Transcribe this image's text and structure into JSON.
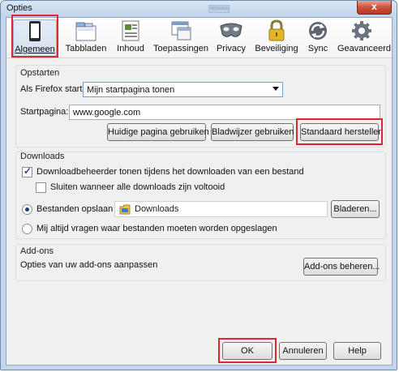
{
  "window": {
    "title": "Opties",
    "ghost_tab": "Verbeteren",
    "close_glyph": "x"
  },
  "toolbar": {
    "tabs": [
      {
        "label": "Algemeen",
        "icon": "general-panel-icon",
        "selected": true
      },
      {
        "label": "Tabbladen",
        "icon": "tabs-panel-icon",
        "selected": false
      },
      {
        "label": "Inhoud",
        "icon": "content-panel-icon",
        "selected": false
      },
      {
        "label": "Toepassingen",
        "icon": "applications-panel-icon",
        "selected": false
      },
      {
        "label": "Privacy",
        "icon": "privacy-mask-icon",
        "selected": false
      },
      {
        "label": "Beveiliging",
        "icon": "padlock-icon",
        "selected": false
      },
      {
        "label": "Sync",
        "icon": "sync-icon",
        "selected": false
      },
      {
        "label": "Geavanceerd",
        "icon": "gear-icon",
        "selected": false
      }
    ]
  },
  "startup": {
    "section_title": "Opstarten",
    "when_starts_label": "Als Firefox start:",
    "when_starts_value": "Mijn startpagina tonen",
    "homepage_label": "Startpagina:",
    "homepage_value": "www.google.com",
    "use_current_button": "Huidige pagina gebruiken",
    "use_bookmark_button": "Bladwijzer gebruiken",
    "restore_default_button": "Standaard herstellen"
  },
  "downloads": {
    "section_title": "Downloads",
    "show_manager_label": "Downloadbeheerder tonen tijdens het downloaden van een bestand",
    "show_manager_checked": true,
    "close_when_done_label": "Sluiten wanneer alle downloads zijn voltooid",
    "close_when_done_checked": false,
    "save_to_label": "Bestanden opslaan in",
    "save_to_folder": "Downloads",
    "browse_button": "Bladeren...",
    "always_ask_label": "Mij altijd vragen waar bestanden moeten worden opgeslagen"
  },
  "addons": {
    "section_title": "Add-ons",
    "options_label": "Opties van uw add-ons aanpassen",
    "manage_button": "Add-ons beheren..."
  },
  "footer": {
    "ok_button": "OK",
    "cancel_button": "Annuleren",
    "help_button": "Help"
  },
  "colors": {
    "highlight_box": "#e0262b",
    "window_frame": "#c3d6ec",
    "client_bg": "#f0f0f0"
  }
}
